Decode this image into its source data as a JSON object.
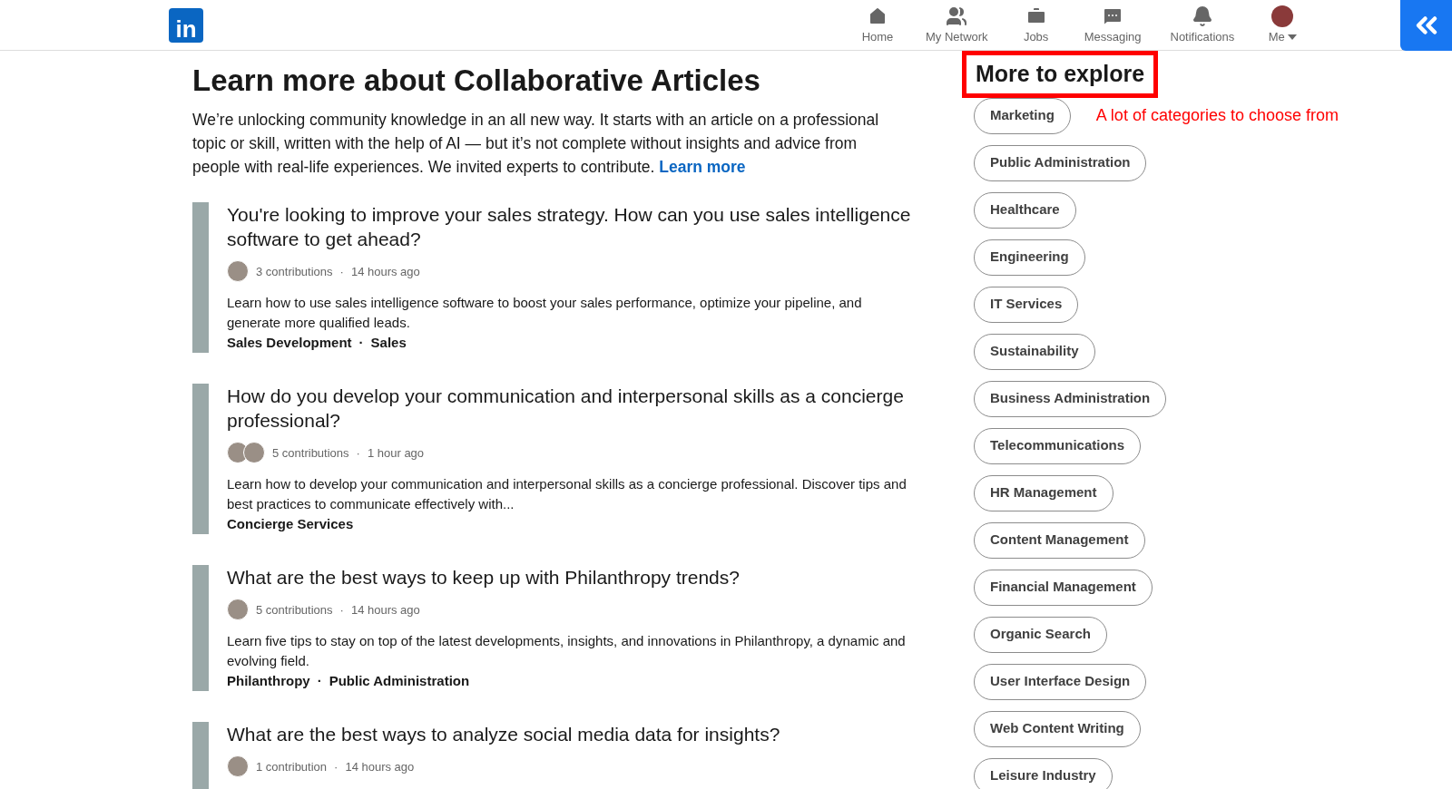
{
  "nav": {
    "logo": "in",
    "items": [
      {
        "kind": "home",
        "label": "Home"
      },
      {
        "kind": "network",
        "label": "My Network"
      },
      {
        "kind": "jobs",
        "label": "Jobs"
      },
      {
        "kind": "messaging",
        "label": "Messaging"
      },
      {
        "kind": "notifications",
        "label": "Notifications"
      },
      {
        "kind": "me",
        "label": "Me"
      }
    ]
  },
  "main": {
    "title": "Learn more about Collaborative Articles",
    "intro": "We’re unlocking community knowledge in an all new way. It starts with an article on a professional topic or skill, written with the help of AI — but it’s not complete without insights and advice from people with real-life experiences. We invited experts to contribute.",
    "intro_link": "Learn more"
  },
  "separator": "·",
  "articles": [
    {
      "title": "You're looking to improve your sales strategy. How can you use sales intelligence software to get ahead?",
      "avatars": [
        {
          "kind": "photo"
        }
      ],
      "contributions": "3 contributions",
      "time": "14 hours ago",
      "summary": "Learn how to use sales intelligence software to boost your sales performance, optimize your pipeline, and generate more qualified leads.",
      "tags": [
        "Sales Development",
        "Sales"
      ]
    },
    {
      "title": "How do you develop your communication and interpersonal skills as a concierge professional?",
      "avatars": [
        {
          "kind": "photo"
        },
        {
          "kind": "photo"
        }
      ],
      "contributions": "5 contributions",
      "time": "1 hour ago",
      "summary": "Learn how to develop your communication and interpersonal skills as a concierge professional. Discover tips and best practices to communicate effectively with...",
      "tags": [
        "Concierge Services"
      ]
    },
    {
      "title": "What are the best ways to keep up with Philanthropy trends?",
      "avatars": [
        {
          "kind": "photo"
        }
      ],
      "contributions": "5 contributions",
      "time": "14 hours ago",
      "summary": "Learn five tips to stay on top of the latest developments, insights, and innovations in Philanthropy, a dynamic and evolving field.",
      "tags": [
        "Philanthropy",
        "Public Administration"
      ]
    },
    {
      "title": "What are the best ways to analyze social media data for insights?",
      "avatars": [
        {
          "kind": "photo"
        }
      ],
      "contributions": "1 contribution",
      "time": "14 hours ago"
    }
  ],
  "explore": {
    "title": "More to explore",
    "annotation": "A lot of categories to choose from",
    "categories": [
      "Marketing",
      "Public Administration",
      "Healthcare",
      "Engineering",
      "IT Services",
      "Sustainability",
      "Business Administration",
      "Telecommunications",
      "HR Management",
      "Content Management",
      "Financial Management",
      "Organic Search",
      "User Interface Design",
      "Web Content Writing",
      "Leisure Industry"
    ]
  }
}
